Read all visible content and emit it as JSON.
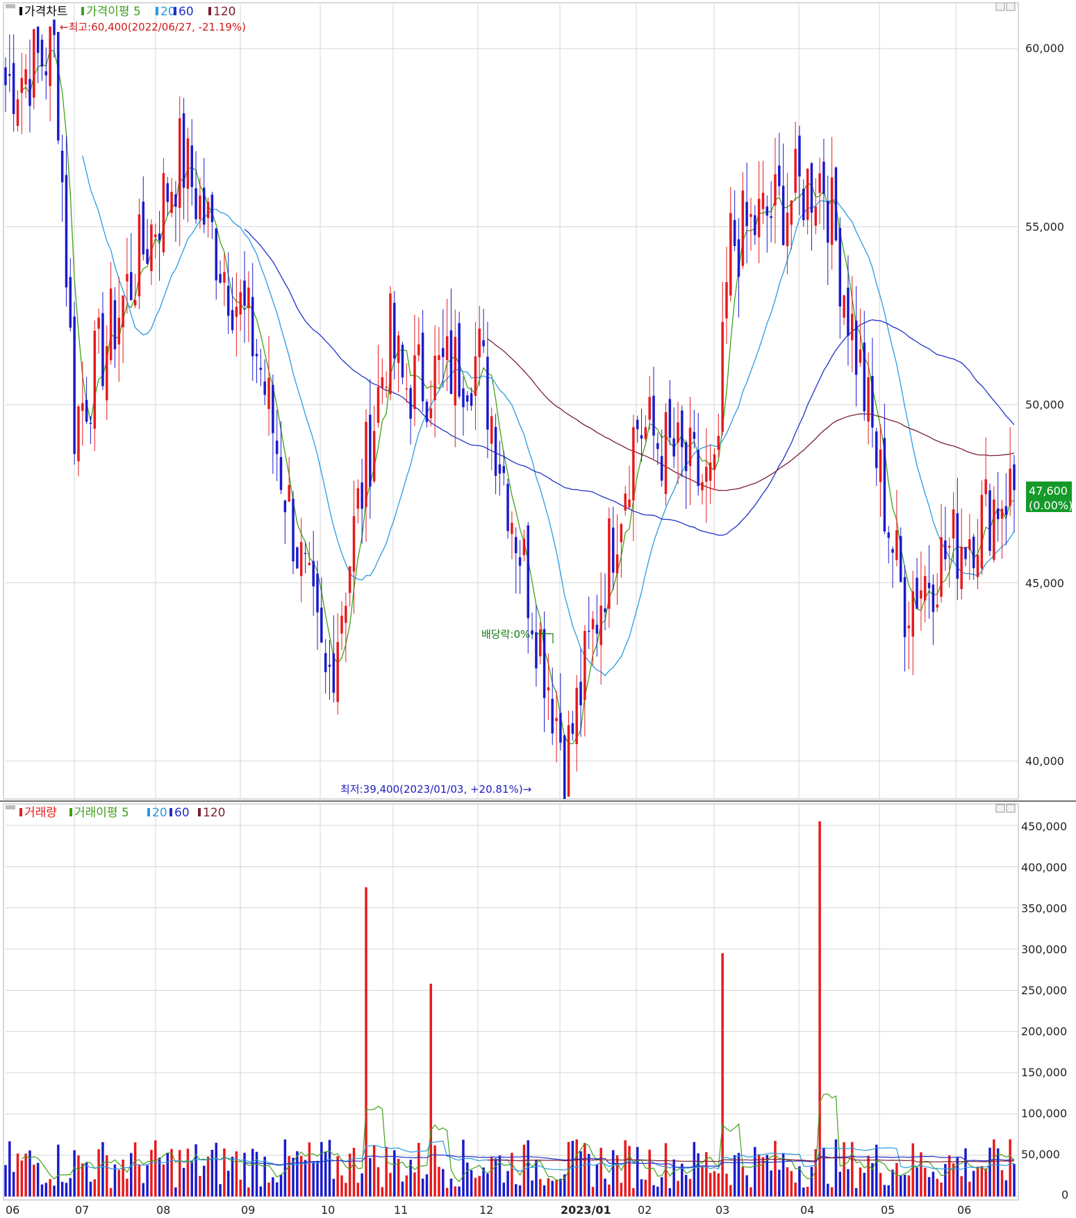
{
  "price_panel": {
    "legend": {
      "title": "가격차트",
      "ma_label": "가격이평 5",
      "ma_periods": [
        "20",
        "60",
        "120"
      ]
    },
    "high_note": "←최고:60,400(2022/06/27, -21.19%)",
    "low_note": "최저:39,400(2023/01/03, +20.81%)→",
    "dividend_note": "배당락:0%",
    "last_price": "47,600",
    "last_change": "(0.00%)",
    "y_ticks": [
      "60,000",
      "55,000",
      "50,000",
      "45,000",
      "40,000"
    ]
  },
  "volume_panel": {
    "legend": {
      "title": "거래량",
      "ma_label": "거래이평 5",
      "ma_periods": [
        "20",
        "60",
        "120"
      ]
    },
    "y_ticks": [
      "450,000",
      "400,000",
      "350,000",
      "300,000",
      "250,000",
      "200,000",
      "150,000",
      "100,000",
      "50,000",
      "0"
    ]
  },
  "x_labels": [
    "06",
    "07",
    "08",
    "09",
    "10",
    "11",
    "12",
    "2023/01",
    "02",
    "03",
    "04",
    "05",
    "06"
  ],
  "colors": {
    "up": "#e8191c",
    "down": "#1a1acc",
    "ma5": "#3fa01a",
    "ma20": "#2a9ae0",
    "ma60": "#2030c8",
    "ma120": "#7a1e32",
    "grid": "#d6d6d6",
    "price_badge": "#159a2a"
  },
  "chart_data": [
    {
      "type": "candlestick",
      "title": "가격차트",
      "series_moving_averages": [
        "5",
        "20",
        "60",
        "120"
      ],
      "ylim": [
        39000,
        61300
      ],
      "y_ticks": [
        40000,
        45000,
        50000,
        55000,
        60000
      ],
      "x_months": [
        "2022/06",
        "2022/07",
        "2022/08",
        "2022/09",
        "2022/10",
        "2022/11",
        "2022/12",
        "2023/01",
        "2023/02",
        "2023/03",
        "2023/04",
        "2023/05",
        "2023/06"
      ],
      "anchors": [
        {
          "month": "2022/06",
          "approx_close": 59000
        },
        {
          "month": "2022/06-end",
          "approx_close": 60000,
          "high": 60400,
          "high_date": "2022/06/27"
        },
        {
          "month": "2022/07",
          "approx_close": 49500
        },
        {
          "month": "2022/08",
          "approx_close": 57000
        },
        {
          "month": "2022/09",
          "approx_close": 51500
        },
        {
          "month": "2022/10",
          "approx_close": 42000
        },
        {
          "month": "2022/10-late",
          "approx_close": 52000
        },
        {
          "month": "2022/11",
          "approx_close": 50500
        },
        {
          "month": "2022/12",
          "approx_close": 51300
        },
        {
          "month": "2023/01",
          "approx_close": 40000,
          "low": 39400,
          "low_date": "2023/01/03"
        },
        {
          "month": "2023/02",
          "approx_close": 49500
        },
        {
          "month": "2023/03",
          "approx_close": 47500
        },
        {
          "month": "2023/03-mid",
          "approx_close": 54500
        },
        {
          "month": "2023/04",
          "approx_close": 56500
        },
        {
          "month": "2023/05",
          "approx_close": 44500
        },
        {
          "month": "2023/06",
          "approx_close": 47600
        }
      ],
      "last": 47600,
      "last_change_pct": 0.0
    },
    {
      "type": "bar",
      "title": "거래량",
      "series_moving_averages": [
        "5",
        "20",
        "60",
        "120"
      ],
      "ylim": [
        0,
        480000
      ],
      "y_ticks": [
        0,
        50000,
        100000,
        150000,
        200000,
        250000,
        300000,
        350000,
        400000,
        450000
      ],
      "notable_spikes": [
        {
          "month": "2022/10-late",
          "value": 375000
        },
        {
          "month": "2022/11",
          "value": 258000
        },
        {
          "month": "2023/03",
          "value": 295000
        },
        {
          "month": "2023/04",
          "value": 455000
        }
      ],
      "typical_range": [
        10000,
        70000
      ]
    }
  ]
}
